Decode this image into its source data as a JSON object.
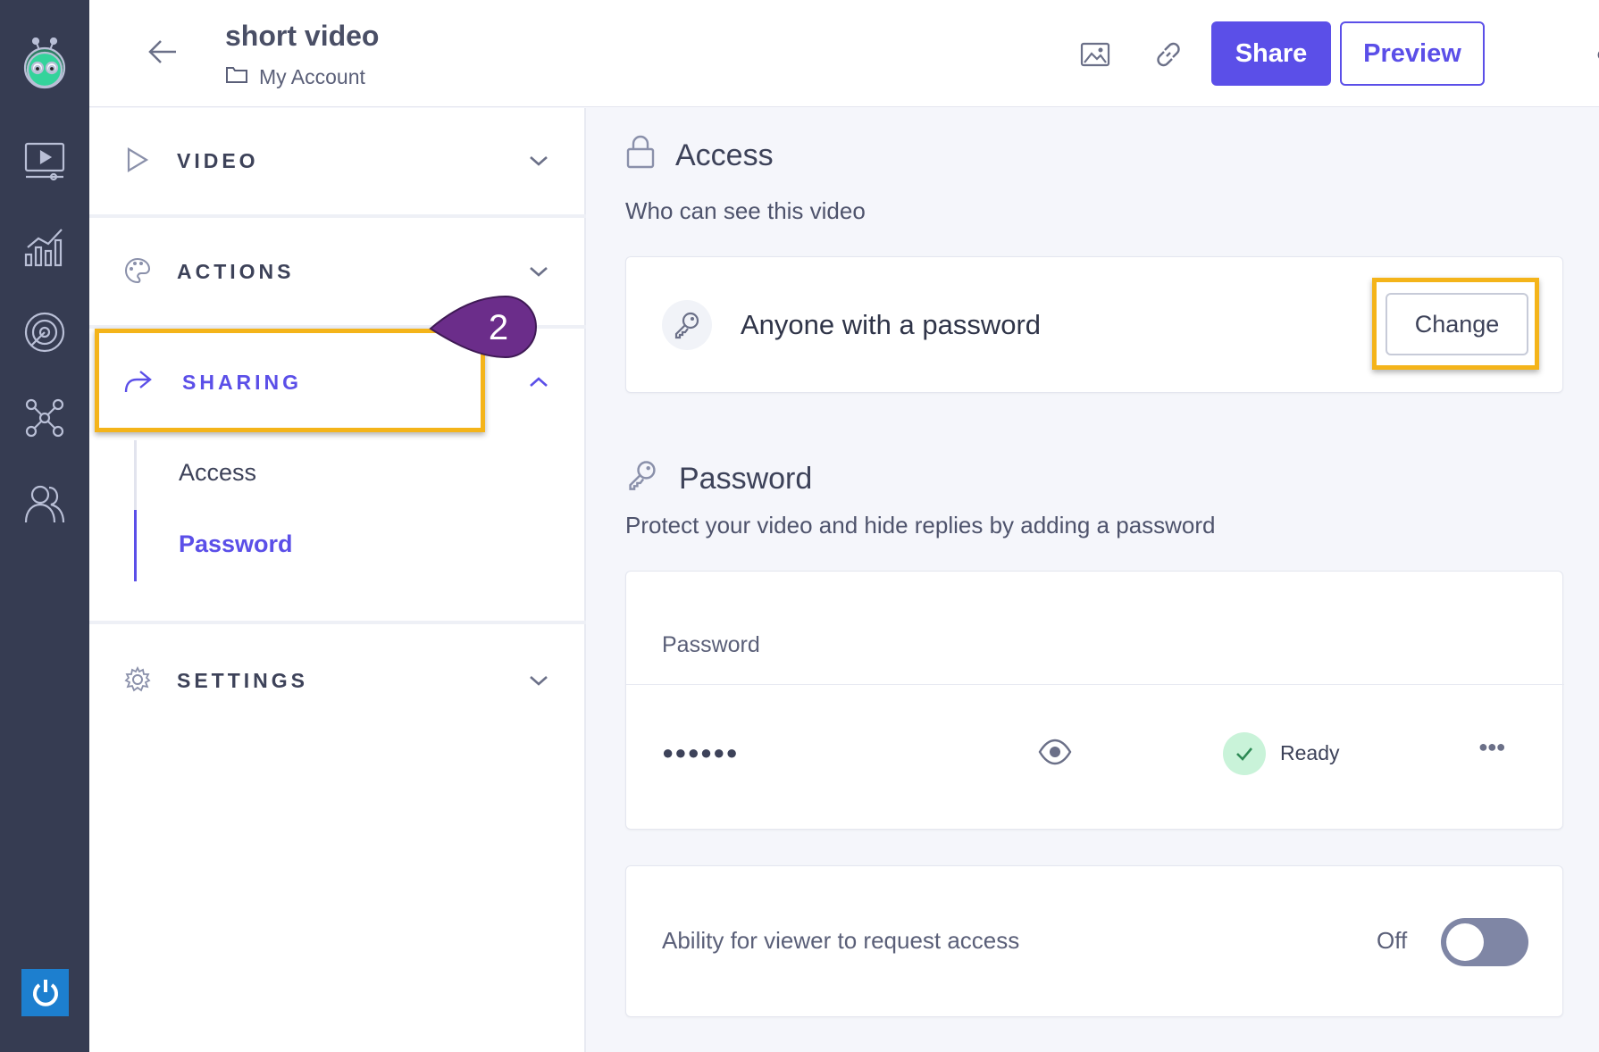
{
  "header": {
    "title": "short video",
    "breadcrumb": "My Account",
    "share_label": "Share",
    "preview_label": "Preview"
  },
  "sidebar": {
    "sections": [
      {
        "label": "VIDEO"
      },
      {
        "label": "ACTIONS"
      },
      {
        "label": "SHARING"
      },
      {
        "label": "SETTINGS"
      }
    ],
    "sub_items": [
      {
        "label": "Access"
      },
      {
        "label": "Password"
      }
    ],
    "callout_number": "2"
  },
  "access": {
    "heading": "Access",
    "subtitle": "Who can see this video",
    "setting": "Anyone with a password",
    "change_label": "Change"
  },
  "password": {
    "heading": "Password",
    "subtitle": "Protect your video and hide replies by adding a password",
    "column_label": "Password",
    "masked_value": "●●●●●●",
    "status": "Ready"
  },
  "request_access": {
    "label": "Ability for viewer to request access",
    "state_label": "Off"
  },
  "colors": {
    "accent": "#5b4fe8",
    "highlight": "#f4b41a",
    "callout": "#6b2d8a",
    "rail": "#363c52"
  }
}
